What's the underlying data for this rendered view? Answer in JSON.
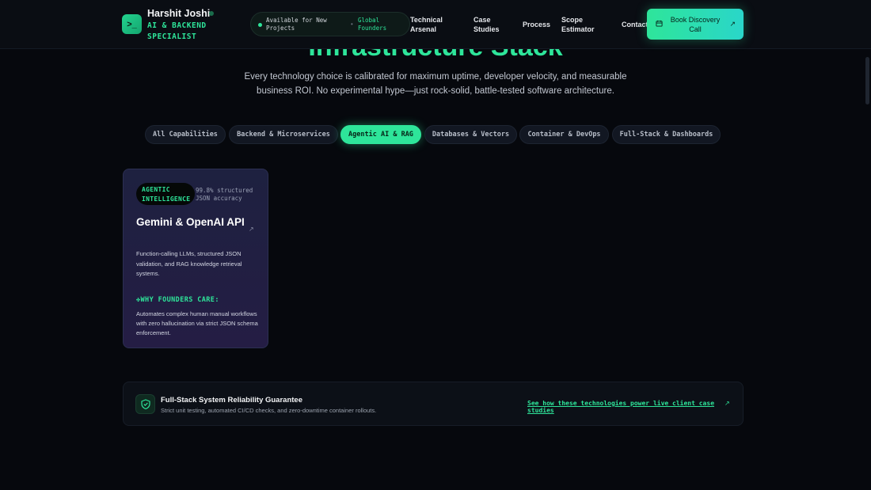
{
  "header": {
    "brand_name": "Harshit Joshi",
    "brand_role": "AI & BACKEND SPECIALIST",
    "availability": "Available for New Projects",
    "separator": "•",
    "availability_tag": "Global Founders",
    "nav": [
      "Technical Arsenal",
      "Case Studies",
      "Process",
      "Scope Estimator",
      "Contact"
    ],
    "cta_label": "Book Discovery Call",
    "icons": {
      "logo": "terminal-icon",
      "cta": "calendar-icon",
      "cta_arrow": "arrow-up-right-icon"
    }
  },
  "hero": {
    "title": "Infrastructure Stack",
    "subtitle": "Every technology choice is calibrated for maximum uptime, developer velocity, and measurable business ROI. No experimental hype—just rock-solid, battle-tested software architecture."
  },
  "tabs": {
    "items": [
      "All Capabilities",
      "Backend & Microservices",
      "Agentic AI & RAG",
      "Databases & Vectors",
      "Container & DevOps",
      "Full-Stack & Dashboards"
    ],
    "active": "Agentic AI & RAG"
  },
  "card": {
    "badge": "AGENTIC INTELLIGENCE",
    "metric": "99.8% structured JSON accuracy",
    "title": "Gemini & OpenAI API",
    "description": "Function-calling LLMs, structured JSON validation, and RAG knowledge retrieval systems.",
    "why_label": "WHY FOUNDERS CARE:",
    "why_text": "Automates complex human manual workflows with zero hallucination via strict JSON schema enforcement."
  },
  "guarantee": {
    "title": "Full-Stack System Reliability Guarantee",
    "subtitle": "Strict unit testing, automated CI/CD checks, and zero-downtime container rollouts.",
    "link": "See how these technologies power live client case studies",
    "icon": "shield-check-icon"
  },
  "colors": {
    "accent": "#2ee59a",
    "background": "#06080d",
    "card": "#1e2140"
  }
}
